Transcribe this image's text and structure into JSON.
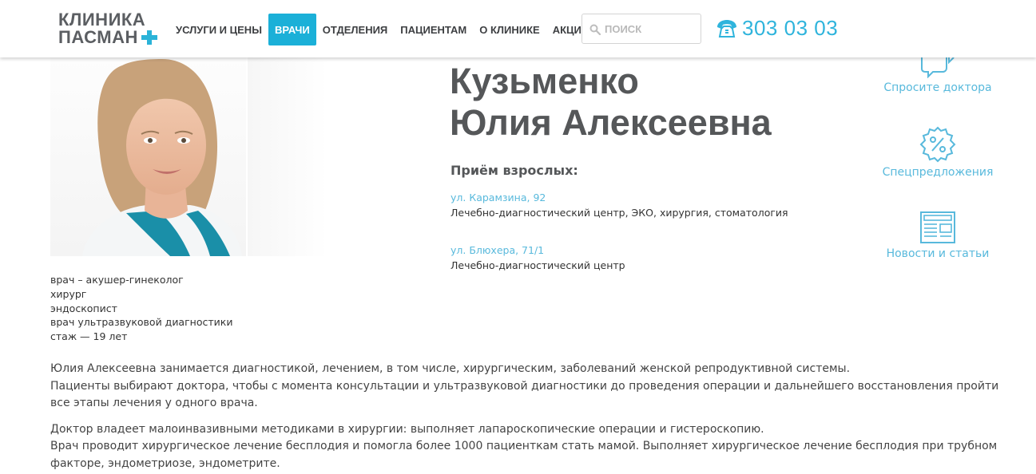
{
  "header": {
    "logo": {
      "line1": "КЛИНИКА",
      "line2": "ПАСМАН"
    },
    "nav": [
      {
        "label": "УСЛУГИ И ЦЕНЫ",
        "active": false
      },
      {
        "label": "ВРАЧИ",
        "active": true
      },
      {
        "label": "ОТДЕЛЕНИЯ",
        "active": false
      },
      {
        "label": "ПАЦИЕНТАМ",
        "active": false
      },
      {
        "label": "О КЛИНИКЕ",
        "active": false
      },
      {
        "label": "АКЦИИ",
        "active": false
      }
    ],
    "search": {
      "placeholder": "ПОИСК",
      "value": ""
    },
    "phone": "303 03 03",
    "accent_color": "#1bb0d8"
  },
  "doctor": {
    "name_line1": "Кузьменко",
    "name_line2": "Юлия Алексеевна",
    "reception_title": "Приём взрослых:",
    "locations": [
      {
        "address": "ул. Карамзина, 92",
        "description": "Лечебно-диагностический центр, ЭКО, хирургия, стоматология"
      },
      {
        "address": "ул. Блюхера, 71/1",
        "description": "Лечебно-диагностический центр"
      }
    ],
    "specialties": [
      "врач – акушер-гинеколог",
      "хирург",
      "эндоскопист",
      "врач ультразвуковой диагностики",
      "стаж — 19 лет"
    ],
    "description": [
      [
        "Юлия Алексеевна занимается диагностикой, лечением, в том числе, хирургическим, заболеваний женской репродуктивной системы.",
        "Пациенты выбирают доктора, чтобы с момента консультации и ультразвуковой диагностики до проведения операции и дальнейшего восстановления пройти все этапы лечения у одного врача."
      ],
      [
        "Доктор владеет малоинвазивными методиками в хирургии: выполняет лапароскопические операции и гистероскопию.",
        "Врач проводит хирургическое лечение бесплодия и помогла более 1000 пациенткам стать мамой. Выполняет хирургическое лечение бесплодия при трубном факторе, эндометриозе, эндометрите."
      ]
    ]
  },
  "side_links": [
    {
      "label": "Спросите доктора",
      "icon": "chat-bubbles-icon"
    },
    {
      "label": "Спецпредложения",
      "icon": "percent-badge-icon"
    },
    {
      "label": "Новости и статьи",
      "icon": "newspaper-icon"
    }
  ]
}
